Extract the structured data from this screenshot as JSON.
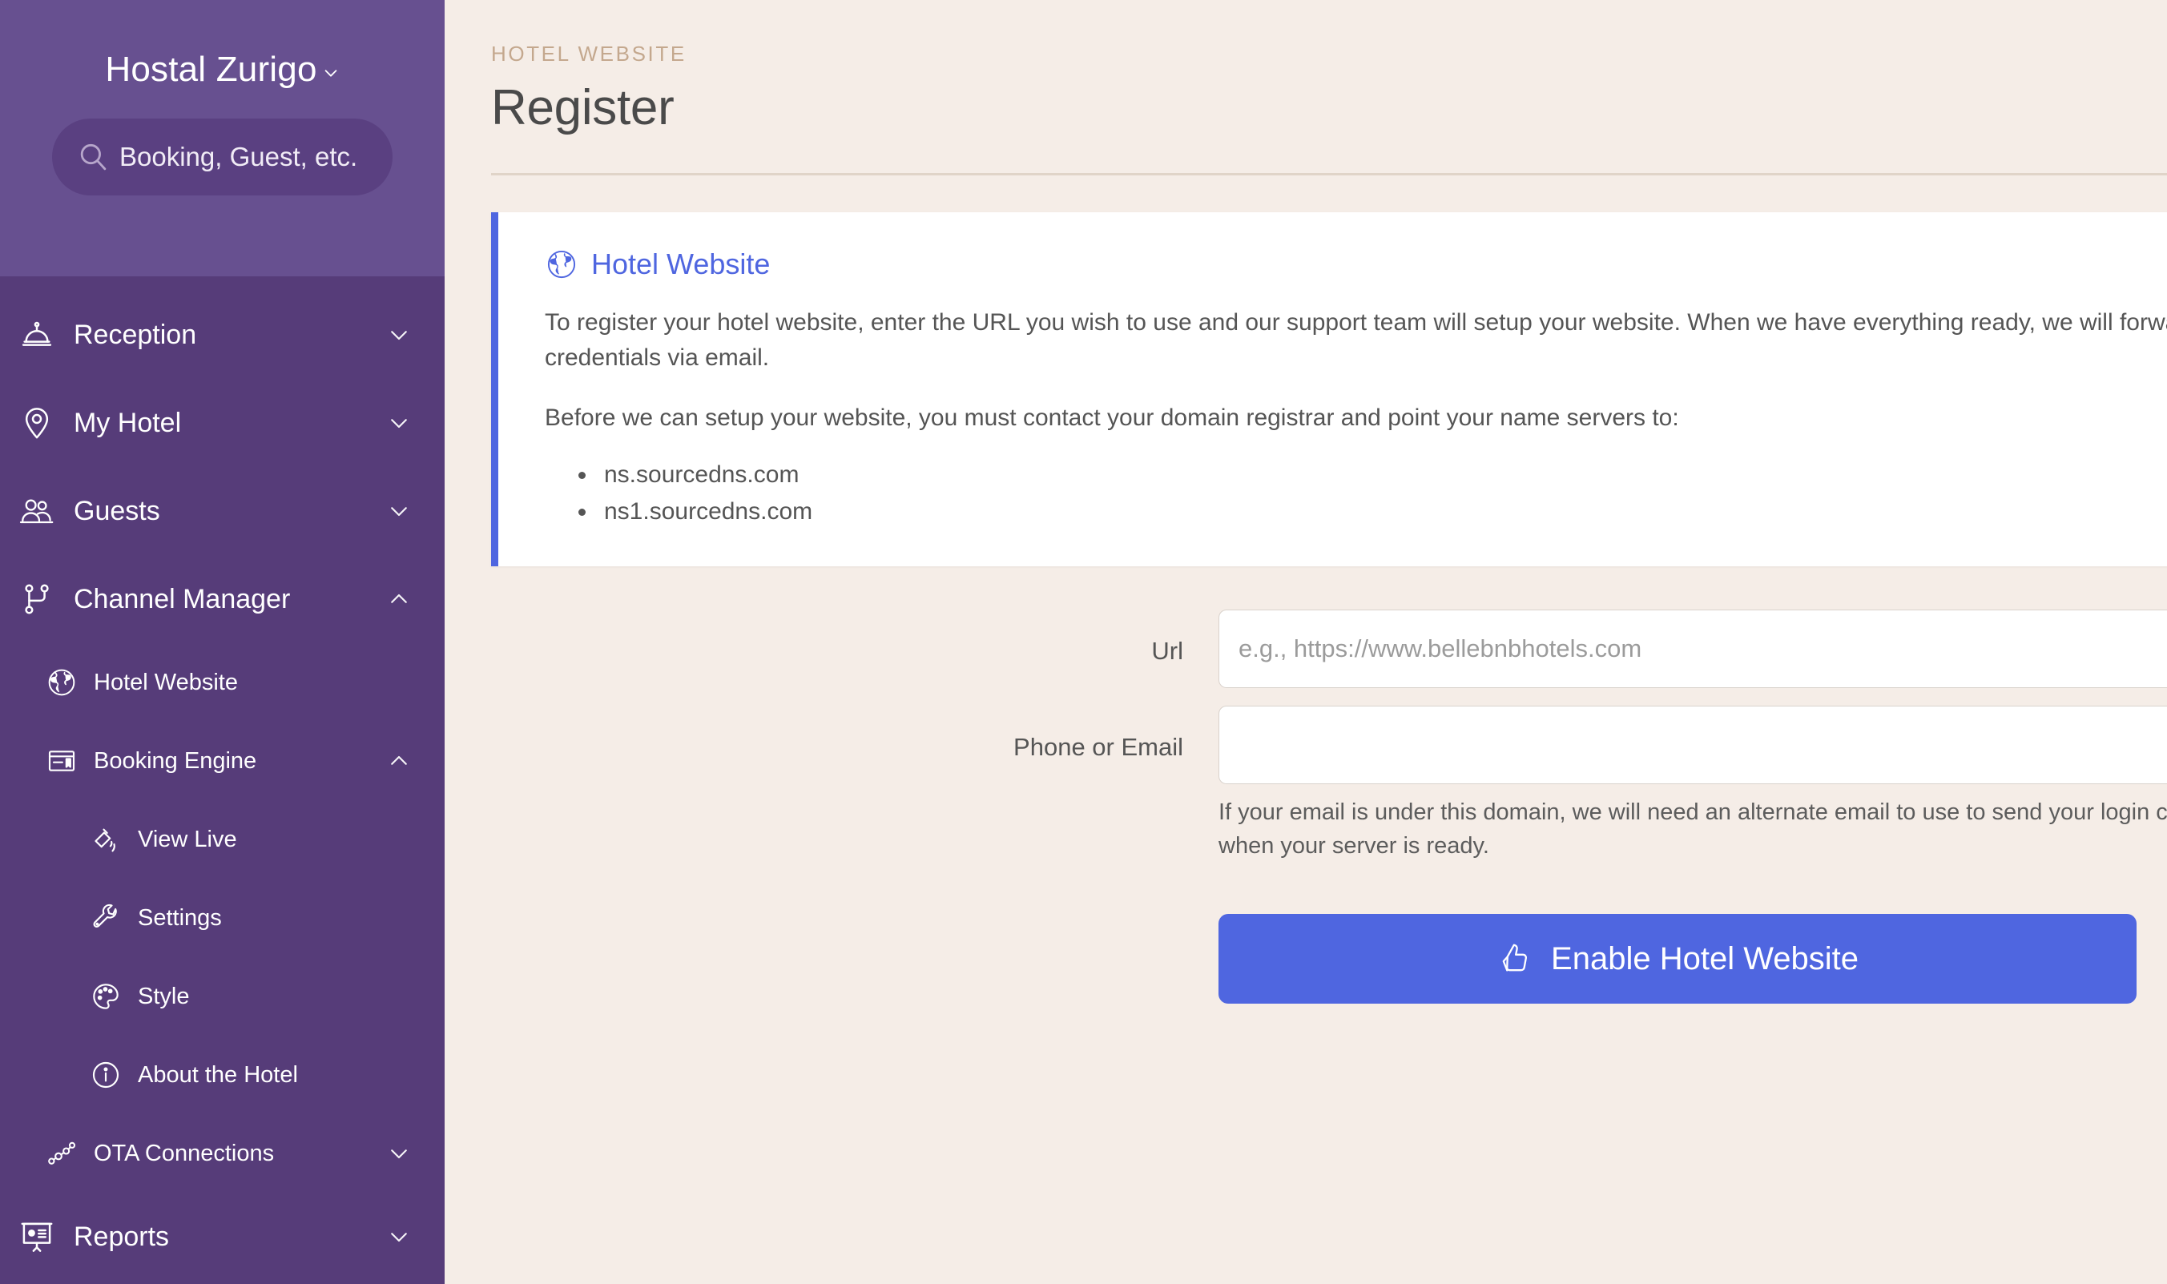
{
  "sidebar": {
    "brand": {
      "name": "Hostal Zurigo",
      "caret_icon": "chevron-down-icon"
    },
    "search": {
      "placeholder": "Booking, Guest, etc.",
      "icon": "search-icon"
    },
    "nav": [
      {
        "label": "Reception",
        "icon": "bell-icon",
        "level": 0,
        "chevron": "down"
      },
      {
        "label": "My Hotel",
        "icon": "map-pin-icon",
        "level": 0,
        "chevron": "down"
      },
      {
        "label": "Guests",
        "icon": "people-icon",
        "level": 0,
        "chevron": "down"
      },
      {
        "label": "Channel Manager",
        "icon": "branch-icon",
        "level": 0,
        "chevron": "up"
      },
      {
        "label": "Hotel Website",
        "icon": "globe-icon",
        "level": 1,
        "chevron": ""
      },
      {
        "label": "Booking Engine",
        "icon": "booking-window-icon",
        "level": 1,
        "chevron": "up"
      },
      {
        "label": "View Live",
        "icon": "broadcast-icon",
        "level": 2,
        "chevron": ""
      },
      {
        "label": "Settings",
        "icon": "wrench-icon",
        "level": 2,
        "chevron": ""
      },
      {
        "label": "Style",
        "icon": "palette-icon",
        "level": 2,
        "chevron": ""
      },
      {
        "label": "About the Hotel",
        "icon": "info-circle-icon",
        "level": 2,
        "chevron": ""
      },
      {
        "label": "OTA Connections",
        "icon": "nodes-icon",
        "level": 1,
        "chevron": "down"
      },
      {
        "label": "Reports",
        "icon": "presentation-icon",
        "level": 0,
        "chevron": "down"
      }
    ]
  },
  "header": {
    "eyebrow": "HOTEL WEBSITE",
    "title": "Register"
  },
  "info_card": {
    "icon": "globe-icon",
    "title": "Hotel Website",
    "paragraph1": "To register your hotel website, enter the URL you wish to use and our support team will setup your website. When we have everything ready, we will forward your credentials via email.",
    "paragraph2": "Before we can setup your website, you must contact your domain registrar and point your name servers to:",
    "nameservers": [
      "ns.sourcedns.com",
      "ns1.sourcedns.com"
    ]
  },
  "form": {
    "url": {
      "label": "Url",
      "placeholder": "e.g., https://www.bellebnbhotels.com",
      "value": ""
    },
    "contact": {
      "label": "Phone or Email",
      "placeholder": "",
      "value": "",
      "help": "If your email is under this domain, we will need an alternate email to use to send your login credentials when your server is ready."
    },
    "submit": {
      "label": "Enable Hotel Website",
      "icon": "thumbs-up-icon"
    }
  },
  "colors": {
    "sidebar_head": "#675090",
    "sidebar_body": "#563C79",
    "page_bg": "#F5EDE7",
    "accent_blue": "#4F66E0",
    "eyebrow": "#C4A88E"
  }
}
